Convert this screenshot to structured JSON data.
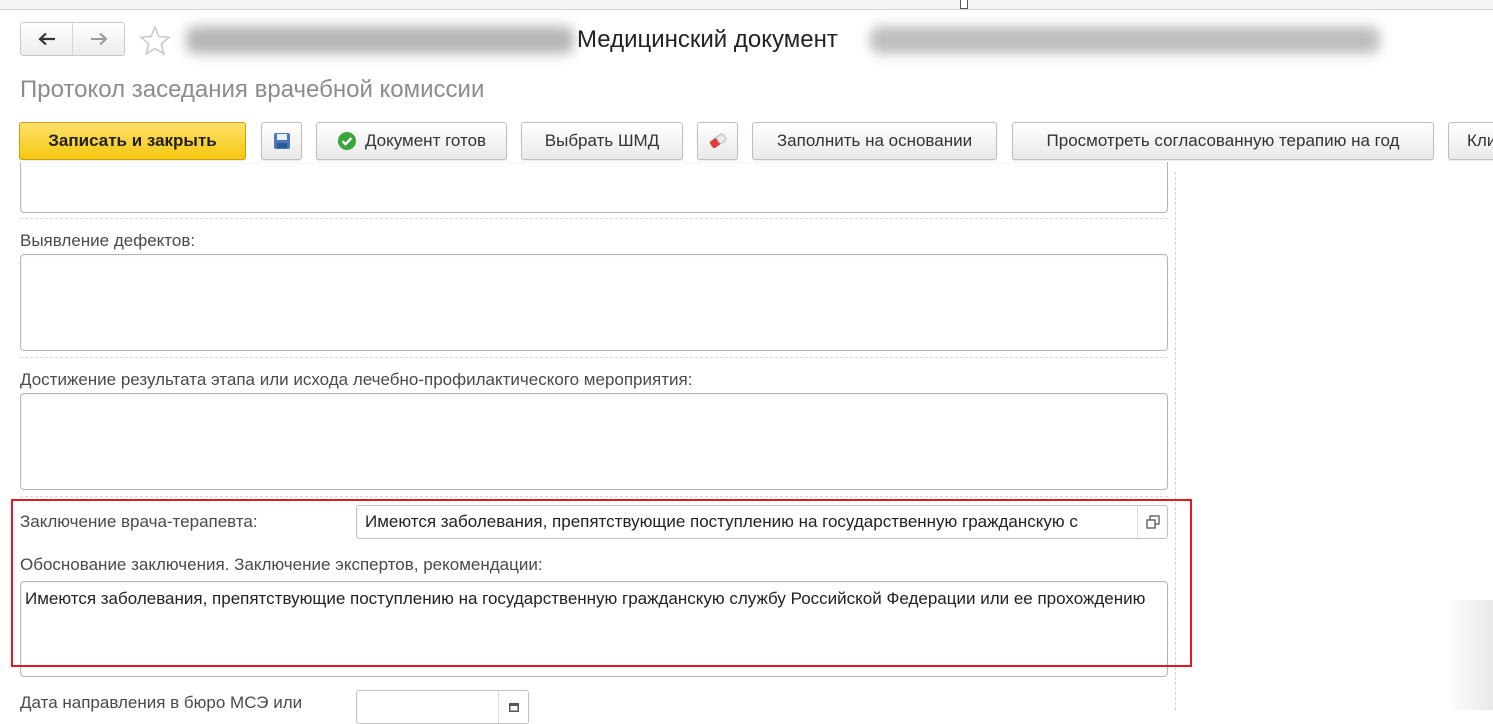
{
  "window": {
    "doc_title": "Медицинский документ",
    "form_title": "Протокол заседания врачебной комиссии"
  },
  "toolbar": {
    "save_close": "Записать и закрыть",
    "doc_ready": "Документ готов",
    "choose_template": "Выбрать ШМД",
    "fill_based_on": "Заполнить на основании",
    "view_therapy": "Просмотреть согласованную терапию на год",
    "cut_off": "Кли"
  },
  "form": {
    "defects_label": "Выявление дефектов:",
    "result_label": "Достижение результата этапа или исхода лечебно-профилактического мероприятия:",
    "therapist_conclusion_label": "Заключение врача-терапевта:",
    "therapist_conclusion_value": "Имеются заболевания, препятствующие поступлению на государственную гражданскую с",
    "justification_label": "Обоснование заключения. Заключение экспертов, рекомендации:",
    "justification_value": "Имеются заболевания, препятствующие поступлению на государственную гражданскую службу Российской Федерации или ее прохождению",
    "mse_date_label": "Дата направления в бюро МСЭ или"
  },
  "colors": {
    "primary_button": "#f5c710",
    "highlight_border": "#e01b24",
    "ready_icon": "#3aa53a"
  },
  "icons": [
    "back-arrow-icon",
    "forward-arrow-icon",
    "favorite-star-icon",
    "save-floppy-icon",
    "check-circle-icon",
    "eraser-icon",
    "open-window-icon",
    "calendar-icon"
  ]
}
